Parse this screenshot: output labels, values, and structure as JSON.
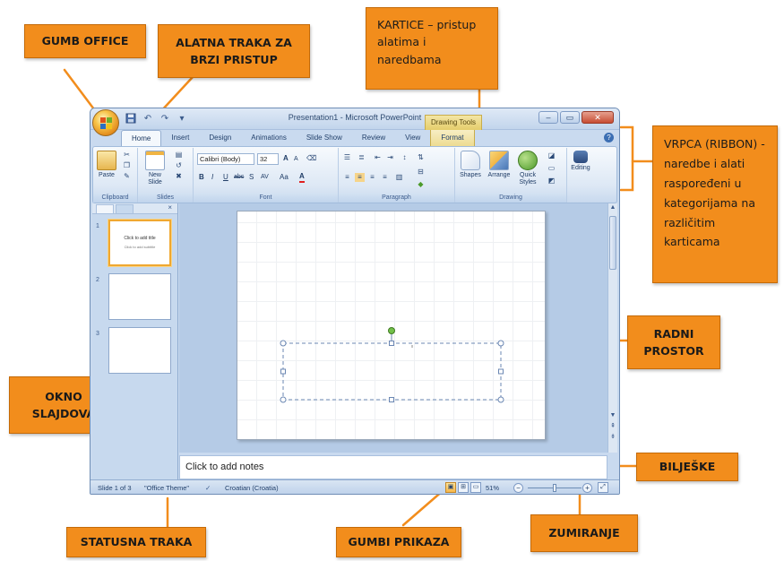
{
  "window": {
    "title": "Presentation1 - Microsoft PowerPoint",
    "context_tab_title": "Drawing Tools",
    "controls": [
      "–",
      "▭",
      "✕"
    ]
  },
  "quick_access": {
    "save_icon": "save-icon",
    "undo_icon": "undo-icon",
    "redo_icon": "redo-icon"
  },
  "tabs": [
    "Home",
    "Insert",
    "Design",
    "Animations",
    "Slide Show",
    "Review",
    "View",
    "Format"
  ],
  "active_tab": "Home",
  "ribbon": {
    "clipboard": {
      "label": "Clipboard",
      "paste": "Paste"
    },
    "slides": {
      "label": "Slides",
      "new_slide": "New Slide"
    },
    "font": {
      "label": "Font",
      "font_name": "Calibri (Body)",
      "font_size": "32",
      "bold": "B",
      "italic": "I",
      "underline": "U",
      "strike": "abc",
      "shadow": "S",
      "spacing": "AV",
      "case": "Aa",
      "color": "A",
      "grow": "A",
      "shrink": "A"
    },
    "paragraph": {
      "label": "Paragraph"
    },
    "drawing": {
      "label": "Drawing",
      "shapes": "Shapes",
      "arrange": "Arrange",
      "quick_styles": "Quick Styles"
    },
    "editing": {
      "label": "Editing"
    }
  },
  "slide_pane": {
    "thumbnails": [
      {
        "number": "1",
        "title": "Click to add title",
        "subtitle": "Click to add subtitle"
      },
      {
        "number": "2"
      },
      {
        "number": "3"
      }
    ]
  },
  "notes_placeholder": "Click to add notes",
  "status_bar": {
    "slide_info": "Slide 1 of 3",
    "theme": "\"Office Theme\"",
    "language": "Croatian (Croatia)",
    "zoom": "51%"
  },
  "callouts": {
    "gumb_office": "GUMB OFFICE",
    "alatna_traka": [
      "ALATNA TRAKA ZA",
      "BRZI PRISTUP"
    ],
    "kartice": [
      "KARTICE – pristup",
      "alatima i",
      "naredbama"
    ],
    "vrpca": [
      "VRPCA (RIBBON) -",
      "naredbe i alati",
      "raspoređeni u",
      "kategorijama na",
      "različitim",
      "karticama"
    ],
    "radni_prostor": [
      "RADNI",
      "PROSTOR"
    ],
    "okno_slajdova": [
      "OKNO",
      "SLAJDOVA"
    ],
    "biljeske": "BILJEŠKE",
    "statusna_traka": "STATUSNA TRAKA",
    "gumbi_prikaza": "GUMBI PRIKAZA",
    "zumiranje": "ZUMIRANJE"
  },
  "colors": {
    "callout": "#f28d1c",
    "pointer": "#f28d1c",
    "window_frame": "#c9daef"
  }
}
